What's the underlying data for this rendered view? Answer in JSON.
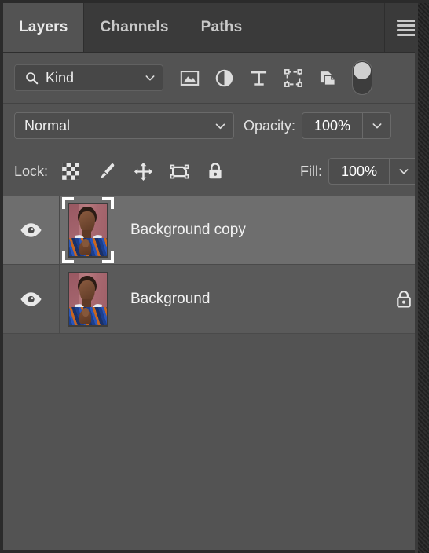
{
  "panel": {
    "title": "Layers",
    "colors": {
      "panel_bg": "#535353",
      "tabbar_bg": "#3a3a3a",
      "row_bg": "#5a5a5a",
      "row_selected_bg": "#6e6e6e",
      "text": "#f2f2f2",
      "field_bg": "#4d4d4d",
      "border": "#6a6a6a"
    }
  },
  "tabs": [
    {
      "label": "Layers",
      "active": true,
      "name": "tab-layers"
    },
    {
      "label": "Channels",
      "active": false,
      "name": "tab-channels"
    },
    {
      "label": "Paths",
      "active": false,
      "name": "tab-paths"
    }
  ],
  "menu": {
    "icon": "hamburger-menu-icon",
    "label": "Panel menu"
  },
  "filter": {
    "kind_label": "Kind",
    "search_icon": "search-icon",
    "dropdown_icon": "chevron-down-icon",
    "icons": [
      {
        "name": "filter-pixel-layers-icon",
        "title": "Filter for pixel layers"
      },
      {
        "name": "filter-adjustment-layers-icon",
        "title": "Filter for adjustment layers"
      },
      {
        "name": "filter-type-layers-icon",
        "title": "Filter for type layers"
      },
      {
        "name": "filter-shape-layers-icon",
        "title": "Filter for shape layers"
      },
      {
        "name": "filter-smart-objects-icon",
        "title": "Filter for smart objects"
      }
    ],
    "toggle": {
      "name": "filter-enable-toggle",
      "state": "on"
    }
  },
  "blend": {
    "mode": "Normal",
    "mode_dropdown_icon": "chevron-down-icon",
    "opacity_label": "Opacity:",
    "opacity_value": "100%",
    "opacity_stepper_icon": "chevron-down-icon"
  },
  "lock": {
    "label": "Lock:",
    "icons": [
      {
        "name": "lock-transparent-pixels-icon",
        "title": "Lock transparent pixels"
      },
      {
        "name": "lock-image-pixels-icon",
        "title": "Lock image pixels"
      },
      {
        "name": "lock-position-icon",
        "title": "Lock position"
      },
      {
        "name": "prevent-nesting-icon",
        "title": "Prevent auto-nesting"
      },
      {
        "name": "lock-all-icon",
        "title": "Lock all"
      }
    ],
    "fill_label": "Fill:",
    "fill_value": "100%",
    "fill_stepper_icon": "chevron-down-icon"
  },
  "layers": [
    {
      "name": "Background copy",
      "selected": true,
      "visible": true,
      "locked": false,
      "visibility_icon": "eye-icon",
      "thumbnail": "portrait-thumbnail"
    },
    {
      "name": "Background",
      "selected": false,
      "visible": true,
      "locked": true,
      "visibility_icon": "eye-icon",
      "lock_icon": "padlock-icon",
      "thumbnail": "portrait-thumbnail"
    }
  ]
}
